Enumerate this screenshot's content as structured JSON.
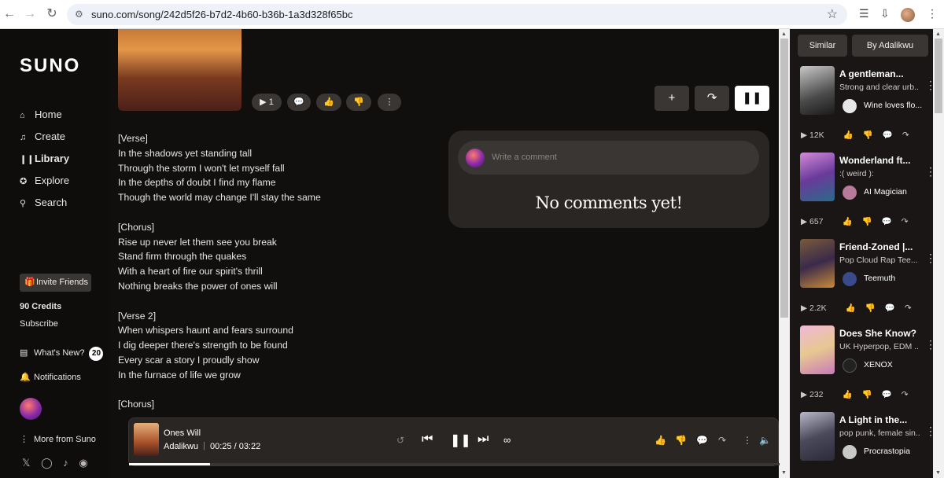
{
  "browser": {
    "url": "suno.com/song/242d5f26-b7d2-4b60-b36b-1a3d328f65bc"
  },
  "sidebar": {
    "logo": "SUNO",
    "nav": [
      {
        "label": "Home",
        "icon": "home-icon"
      },
      {
        "label": "Create",
        "icon": "music-note-icon"
      },
      {
        "label": "Library",
        "icon": "library-icon"
      },
      {
        "label": "Explore",
        "icon": "compass-icon"
      },
      {
        "label": "Search",
        "icon": "search-icon"
      }
    ],
    "invite_label": "Invite Friends",
    "credits": "90 Credits",
    "subscribe": "Subscribe",
    "whats_new": "What's New?",
    "whats_new_count": "20",
    "notifications": "Notifications",
    "more": "More from Suno"
  },
  "song": {
    "play_count": "1",
    "lyrics": "[Verse]\nIn the shadows yet standing tall\nThrough the storm I won't let myself fall\nIn the depths of doubt I find my flame\nThough the world may change I'll stay the same\n\n[Chorus]\nRise up never let them see you break\nStand firm through the quakes\nWith a heart of fire our spirit's thrill\nNothing breaks the power of ones will\n\n[Verse 2]\nWhen whispers haunt and fears surround\nI dig deeper there's strength to be found\nEvery scar a story I proudly show\nIn the furnace of life we grow\n\n[Chorus]"
  },
  "comments": {
    "placeholder": "Write a comment",
    "empty": "No comments yet!"
  },
  "right_panel": {
    "tabs": [
      "Similar",
      "By Adalikwu"
    ],
    "cards": [
      {
        "title": "A gentleman...",
        "subtitle": "Strong and clear urb...",
        "user": "Wine loves flo...",
        "plays": "12K"
      },
      {
        "title": "Wonderland ft...",
        "subtitle": ":( weird ):",
        "user": "AI Magician",
        "plays": "657"
      },
      {
        "title": "Friend-Zoned |...",
        "subtitle": "Pop Cloud Rap Tee...",
        "user": "Teemuth",
        "plays": "2.2K"
      },
      {
        "title": "Does She Know?",
        "subtitle": "UK Hyperpop, EDM ...",
        "user": "XENOX",
        "plays": "232"
      },
      {
        "title": "A Light in the...",
        "subtitle": "pop punk, female sin...",
        "user": "Procrastopia",
        "plays": ""
      }
    ]
  },
  "player": {
    "title": "Ones Will",
    "artist": "Adalikwu",
    "time": "00:25 / 03:22",
    "progress": 0.124
  }
}
